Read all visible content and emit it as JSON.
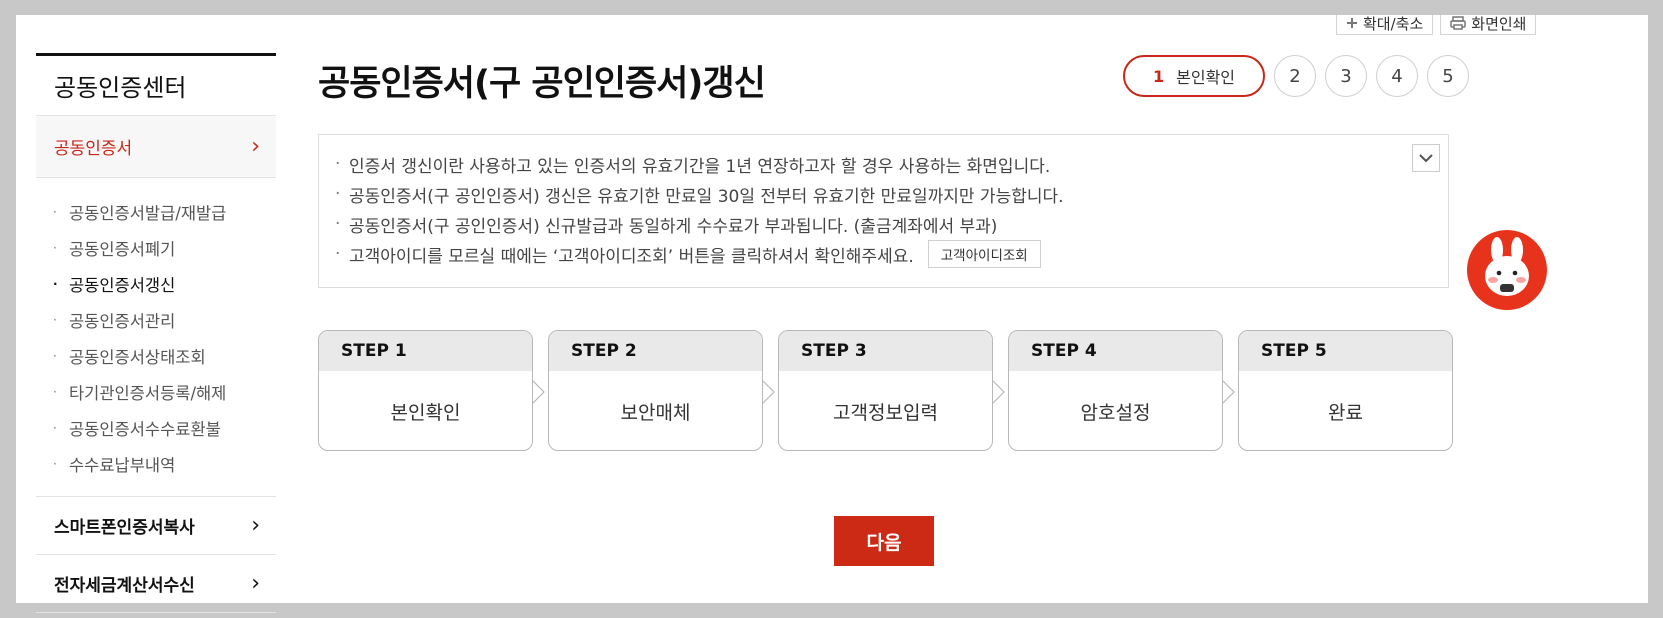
{
  "util": {
    "zoom_label": "확대/축소",
    "print_label": "화면인쇄"
  },
  "sidebar": {
    "title": "공동인증센터",
    "active_section": "공동인증서",
    "sub_items": [
      "공동인증서발급/재발급",
      "공동인증서폐기",
      "공동인증서갱신",
      "공동인증서관리",
      "공동인증서상태조회",
      "타기관인증서등록/해제",
      "공동인증서수수료환불",
      "수수료납부내역"
    ],
    "current_sub_index": 2,
    "sections": [
      "스마트폰인증서복사",
      "전자세금계산서수신"
    ]
  },
  "main": {
    "title": "공동인증서(구 공인인증서)갱신",
    "stepper": {
      "active_number": "1",
      "active_label": "본인확인",
      "others": [
        "2",
        "3",
        "4",
        "5"
      ]
    },
    "notice": [
      "인증서 갱신이란 사용하고 있는 인증서의 유효기간을 1년 연장하고자 할 경우 사용하는 화면입니다.",
      "공동인증서(구 공인인증서) 갱신은 유효기한 만료일 30일 전부터 유효기한 만료일까지만 가능합니다.",
      "공동인증서(구 공인인증서) 신규발급과 동일하게 수수료가 부과됩니다. (출금계좌에서 부과)",
      "고객아이디를 모르실 때에는 ‘고객아이디조회’ 버튼을 클릭하셔서 확인해주세요."
    ],
    "id_lookup_button": "고객아이디조회",
    "steps": [
      {
        "step": "STEP 1",
        "label": "본인확인"
      },
      {
        "step": "STEP 2",
        "label": "보안매체"
      },
      {
        "step": "STEP 3",
        "label": "고객정보입력"
      },
      {
        "step": "STEP 4",
        "label": "암호설정"
      },
      {
        "step": "STEP 5",
        "label": "완료"
      }
    ],
    "next_button": "다음"
  },
  "colors": {
    "accent": "#c8271a",
    "button": "#cc2a15",
    "step_header": "#e9e9ea"
  }
}
